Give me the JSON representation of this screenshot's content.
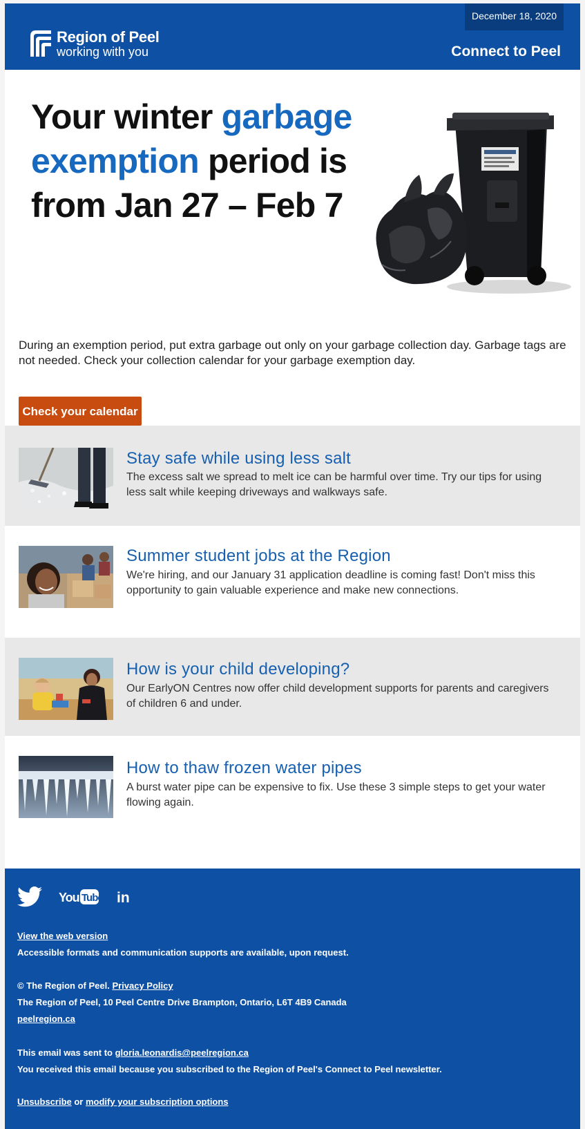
{
  "header": {
    "date": "December 18, 2020",
    "logo_title": "Region of Peel",
    "logo_subtitle": "working with you",
    "connect_link": "Connect to Peel",
    "brand_color": "#0e50a3"
  },
  "hero": {
    "title_part1": "Your winter ",
    "title_accent1": "garbage",
    "title_accent2": "exemption",
    "title_part2": " period is",
    "title_part3": "from Jan 27 – Feb 7",
    "illustration": "garbage-cart-and-bags",
    "accent_color": "#1769bf"
  },
  "intro": {
    "text": "During an exemption period, put extra garbage out only on your garbage collection day. Garbage tags are not needed. Check your collection calendar for your garbage exemption day.",
    "cta_label": "Check your calendar",
    "cta_color": "#c84b0f"
  },
  "articles": [
    {
      "title": "Stay safe while using less salt",
      "body": "The excess salt we spread to melt ice can be harmful over time. Try our tips for using less salt while keeping driveways and walkways safe.",
      "image": "salt-spreading-photo"
    },
    {
      "title": "Summer student jobs at the Region",
      "body": "We're hiring, and our January 31 application deadline is coming fast! Don't miss this opportunity to gain valuable experience and make new connections.",
      "image": "student-volunteers-photo"
    },
    {
      "title": "How is your child developing?",
      "body": "Our EarlyON Centres now offer child development supports for parents and caregivers of children 6 and under.",
      "image": "child-playing-photo"
    },
    {
      "title": "How to thaw frozen water pipes",
      "body": "A burst water pipe can be expensive to fix. Use these 3 simple steps to get your water flowing again.",
      "image": "icicles-photo"
    }
  ],
  "footer": {
    "social": [
      {
        "name": "twitter-icon",
        "label": ""
      },
      {
        "name": "youtube-icon",
        "label": "YouTube"
      },
      {
        "name": "linkedin-icon",
        "label": "in"
      }
    ],
    "view_web": "View the web version",
    "accessible": "Accessible formats and communication supports are available, upon request.",
    "copyright": "© The Region of Peel. ",
    "privacy": "Privacy Policy",
    "address": "The Region of Peel, 10 Peel Centre Drive Brampton, Ontario, L6T 4B9 Canada",
    "website": "peelregion.ca",
    "sent_to_prefix": "This email was sent to ",
    "sent_to_email": "gloria.leonardis@peelregion.ca",
    "received_reason": "You received this email because you subscribed to the Region of Peel's Connect to Peel newsletter.",
    "unsubscribe": "Unsubscribe",
    "or": " or ",
    "modify": "modify your subscription options"
  }
}
